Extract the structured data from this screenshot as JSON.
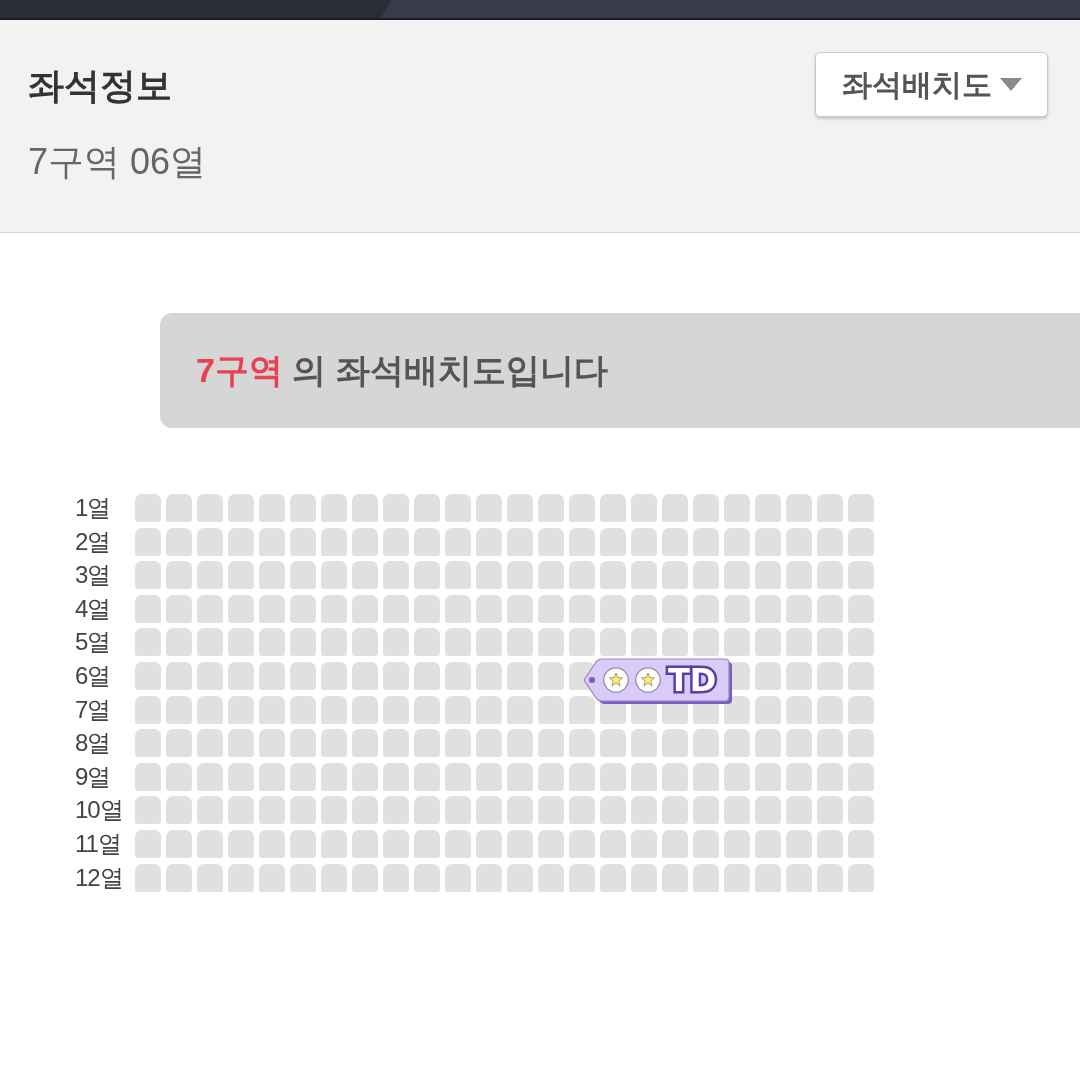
{
  "header": {
    "title": "좌석정보",
    "subtitle": "7구역 06열",
    "button": {
      "label": "좌석배치도"
    }
  },
  "banner": {
    "zone": "7구역",
    "text": "의 좌석배치도입니다"
  },
  "seat_map": {
    "rows": [
      {
        "label": "1열",
        "seats": [
          {
            "kind": "seat"
          },
          {
            "kind": "seat"
          },
          {
            "kind": "seat"
          },
          {
            "kind": "seat"
          },
          {
            "kind": "seat"
          },
          {
            "kind": "seat"
          },
          {
            "kind": "seat"
          },
          {
            "kind": "seat"
          },
          {
            "kind": "seat"
          },
          {
            "kind": "seat"
          },
          {
            "kind": "seat"
          },
          {
            "kind": "seat"
          },
          {
            "kind": "seat"
          },
          {
            "kind": "seat"
          },
          {
            "kind": "seat"
          },
          {
            "kind": "seat"
          },
          {
            "kind": "seat"
          },
          {
            "kind": "seat"
          },
          {
            "kind": "seat"
          },
          {
            "kind": "seat"
          },
          {
            "kind": "seat"
          },
          {
            "kind": "seat"
          },
          {
            "kind": "seat"
          },
          {
            "kind": "seat"
          }
        ]
      },
      {
        "label": "2열",
        "seats": [
          {
            "kind": "seat"
          },
          {
            "kind": "seat"
          },
          {
            "kind": "seat"
          },
          {
            "kind": "seat"
          },
          {
            "kind": "seat"
          },
          {
            "kind": "seat"
          },
          {
            "kind": "seat"
          },
          {
            "kind": "seat"
          },
          {
            "kind": "seat"
          },
          {
            "kind": "seat"
          },
          {
            "kind": "seat"
          },
          {
            "kind": "seat"
          },
          {
            "kind": "seat"
          },
          {
            "kind": "seat"
          },
          {
            "kind": "seat"
          },
          {
            "kind": "seat"
          },
          {
            "kind": "seat"
          },
          {
            "kind": "seat"
          },
          {
            "kind": "seat"
          },
          {
            "kind": "seat"
          },
          {
            "kind": "seat"
          },
          {
            "kind": "seat"
          },
          {
            "kind": "seat"
          },
          {
            "kind": "seat"
          }
        ]
      },
      {
        "label": "3열",
        "seats": [
          {
            "kind": "seat"
          },
          {
            "kind": "seat"
          },
          {
            "kind": "seat"
          },
          {
            "kind": "seat"
          },
          {
            "kind": "seat"
          },
          {
            "kind": "seat"
          },
          {
            "kind": "seat"
          },
          {
            "kind": "seat"
          },
          {
            "kind": "seat"
          },
          {
            "kind": "seat"
          },
          {
            "kind": "seat"
          },
          {
            "kind": "seat"
          },
          {
            "kind": "seat"
          },
          {
            "kind": "seat"
          },
          {
            "kind": "seat"
          },
          {
            "kind": "seat"
          },
          {
            "kind": "seat"
          },
          {
            "kind": "seat"
          },
          {
            "kind": "seat"
          },
          {
            "kind": "seat"
          },
          {
            "kind": "seat"
          },
          {
            "kind": "seat"
          },
          {
            "kind": "seat"
          },
          {
            "kind": "seat"
          }
        ]
      },
      {
        "label": "4열",
        "seats": [
          {
            "kind": "seat"
          },
          {
            "kind": "seat"
          },
          {
            "kind": "seat"
          },
          {
            "kind": "seat"
          },
          {
            "kind": "seat"
          },
          {
            "kind": "seat"
          },
          {
            "kind": "seat"
          },
          {
            "kind": "seat"
          },
          {
            "kind": "seat"
          },
          {
            "kind": "seat"
          },
          {
            "kind": "seat"
          },
          {
            "kind": "seat"
          },
          {
            "kind": "seat"
          },
          {
            "kind": "seat"
          },
          {
            "kind": "seat"
          },
          {
            "kind": "seat"
          },
          {
            "kind": "seat"
          },
          {
            "kind": "seat"
          },
          {
            "kind": "seat"
          },
          {
            "kind": "seat"
          },
          {
            "kind": "seat"
          },
          {
            "kind": "seat"
          },
          {
            "kind": "seat"
          },
          {
            "kind": "seat"
          }
        ]
      },
      {
        "label": "5열",
        "seats": [
          {
            "kind": "seat"
          },
          {
            "kind": "seat"
          },
          {
            "kind": "seat"
          },
          {
            "kind": "seat"
          },
          {
            "kind": "seat"
          },
          {
            "kind": "seat"
          },
          {
            "kind": "seat"
          },
          {
            "kind": "seat"
          },
          {
            "kind": "seat"
          },
          {
            "kind": "seat"
          },
          {
            "kind": "seat"
          },
          {
            "kind": "seat"
          },
          {
            "kind": "seat"
          },
          {
            "kind": "seat"
          },
          {
            "kind": "seat"
          },
          {
            "kind": "seat"
          },
          {
            "kind": "seat"
          },
          {
            "kind": "seat"
          },
          {
            "kind": "seat"
          },
          {
            "kind": "seat"
          },
          {
            "kind": "seat"
          },
          {
            "kind": "seat"
          },
          {
            "kind": "seat"
          },
          {
            "kind": "seat"
          }
        ]
      },
      {
        "label": "6열",
        "seats": [
          {
            "kind": "seat"
          },
          {
            "kind": "seat"
          },
          {
            "kind": "seat"
          },
          {
            "kind": "seat"
          },
          {
            "kind": "seat"
          },
          {
            "kind": "seat"
          },
          {
            "kind": "seat"
          },
          {
            "kind": "seat"
          },
          {
            "kind": "seat"
          },
          {
            "kind": "seat"
          },
          {
            "kind": "seat"
          },
          {
            "kind": "seat"
          },
          {
            "kind": "seat"
          },
          {
            "kind": "seat"
          },
          {
            "kind": "seat"
          },
          {
            "kind": "covered"
          },
          {
            "kind": "covered"
          },
          {
            "kind": "covered"
          },
          {
            "kind": "covered"
          },
          {
            "kind": "seat"
          },
          {
            "kind": "seat"
          },
          {
            "kind": "seat"
          },
          {
            "kind": "seat"
          },
          {
            "kind": "seat"
          }
        ]
      },
      {
        "label": "7열",
        "seats": [
          {
            "kind": "seat"
          },
          {
            "kind": "seat"
          },
          {
            "kind": "seat"
          },
          {
            "kind": "seat"
          },
          {
            "kind": "seat"
          },
          {
            "kind": "seat"
          },
          {
            "kind": "seat"
          },
          {
            "kind": "seat"
          },
          {
            "kind": "seat"
          },
          {
            "kind": "seat"
          },
          {
            "kind": "seat"
          },
          {
            "kind": "seat"
          },
          {
            "kind": "seat"
          },
          {
            "kind": "seat"
          },
          {
            "kind": "seat"
          },
          {
            "kind": "seat"
          },
          {
            "kind": "seat"
          },
          {
            "kind": "seat"
          },
          {
            "kind": "seat"
          },
          {
            "kind": "seat"
          },
          {
            "kind": "seat"
          },
          {
            "kind": "seat"
          },
          {
            "kind": "seat"
          },
          {
            "kind": "seat"
          }
        ]
      },
      {
        "label": "8열",
        "seats": [
          {
            "kind": "seat"
          },
          {
            "kind": "seat"
          },
          {
            "kind": "seat"
          },
          {
            "kind": "seat"
          },
          {
            "kind": "seat"
          },
          {
            "kind": "seat"
          },
          {
            "kind": "seat"
          },
          {
            "kind": "seat"
          },
          {
            "kind": "seat"
          },
          {
            "kind": "seat"
          },
          {
            "kind": "seat"
          },
          {
            "kind": "seat"
          },
          {
            "kind": "seat"
          },
          {
            "kind": "seat"
          },
          {
            "kind": "seat"
          },
          {
            "kind": "seat"
          },
          {
            "kind": "seat"
          },
          {
            "kind": "seat"
          },
          {
            "kind": "seat"
          },
          {
            "kind": "seat"
          },
          {
            "kind": "seat"
          },
          {
            "kind": "seat"
          },
          {
            "kind": "seat"
          },
          {
            "kind": "seat"
          }
        ]
      },
      {
        "label": "9열",
        "seats": [
          {
            "kind": "seat"
          },
          {
            "kind": "seat"
          },
          {
            "kind": "seat"
          },
          {
            "kind": "seat"
          },
          {
            "kind": "seat"
          },
          {
            "kind": "seat"
          },
          {
            "kind": "seat"
          },
          {
            "kind": "seat"
          },
          {
            "kind": "seat"
          },
          {
            "kind": "seat"
          },
          {
            "kind": "seat"
          },
          {
            "kind": "seat"
          },
          {
            "kind": "seat"
          },
          {
            "kind": "seat"
          },
          {
            "kind": "seat"
          },
          {
            "kind": "seat"
          },
          {
            "kind": "seat"
          },
          {
            "kind": "seat"
          },
          {
            "kind": "seat"
          },
          {
            "kind": "seat"
          },
          {
            "kind": "seat"
          },
          {
            "kind": "seat"
          },
          {
            "kind": "seat"
          },
          {
            "kind": "seat"
          }
        ]
      },
      {
        "label": "10열",
        "seats": [
          {
            "kind": "seat"
          },
          {
            "kind": "seat"
          },
          {
            "kind": "seat"
          },
          {
            "kind": "seat"
          },
          {
            "kind": "seat"
          },
          {
            "kind": "seat"
          },
          {
            "kind": "seat"
          },
          {
            "kind": "seat"
          },
          {
            "kind": "seat"
          },
          {
            "kind": "seat"
          },
          {
            "kind": "seat"
          },
          {
            "kind": "seat"
          },
          {
            "kind": "seat"
          },
          {
            "kind": "seat"
          },
          {
            "kind": "seat"
          },
          {
            "kind": "seat"
          },
          {
            "kind": "seat"
          },
          {
            "kind": "seat"
          },
          {
            "kind": "seat"
          },
          {
            "kind": "seat"
          },
          {
            "kind": "seat"
          },
          {
            "kind": "seat"
          },
          {
            "kind": "seat"
          },
          {
            "kind": "seat"
          }
        ]
      },
      {
        "label": "11열",
        "seats": [
          {
            "kind": "seat"
          },
          {
            "kind": "seat"
          },
          {
            "kind": "seat"
          },
          {
            "kind": "seat"
          },
          {
            "kind": "seat"
          },
          {
            "kind": "seat"
          },
          {
            "kind": "seat"
          },
          {
            "kind": "seat"
          },
          {
            "kind": "seat"
          },
          {
            "kind": "seat"
          },
          {
            "kind": "seat"
          },
          {
            "kind": "seat"
          },
          {
            "kind": "seat"
          },
          {
            "kind": "seat"
          },
          {
            "kind": "seat"
          },
          {
            "kind": "seat"
          },
          {
            "kind": "seat"
          },
          {
            "kind": "seat"
          },
          {
            "kind": "seat"
          },
          {
            "kind": "seat"
          },
          {
            "kind": "seat"
          },
          {
            "kind": "seat"
          },
          {
            "kind": "seat"
          },
          {
            "kind": "seat"
          }
        ]
      },
      {
        "label": "12열",
        "seats": [
          {
            "kind": "seat"
          },
          {
            "kind": "seat"
          },
          {
            "kind": "seat"
          },
          {
            "kind": "seat"
          },
          {
            "kind": "seat"
          },
          {
            "kind": "seat"
          },
          {
            "kind": "seat"
          },
          {
            "kind": "seat"
          },
          {
            "kind": "seat"
          },
          {
            "kind": "seat"
          },
          {
            "kind": "seat"
          },
          {
            "kind": "seat"
          },
          {
            "kind": "seat"
          },
          {
            "kind": "seat"
          },
          {
            "kind": "seat"
          },
          {
            "kind": "seat"
          },
          {
            "kind": "seat"
          },
          {
            "kind": "seat"
          },
          {
            "kind": "seat"
          },
          {
            "kind": "seat"
          },
          {
            "kind": "seat"
          },
          {
            "kind": "seat"
          },
          {
            "kind": "seat"
          },
          {
            "kind": "seat"
          }
        ]
      }
    ]
  },
  "sticker": {
    "text": "TD"
  }
}
